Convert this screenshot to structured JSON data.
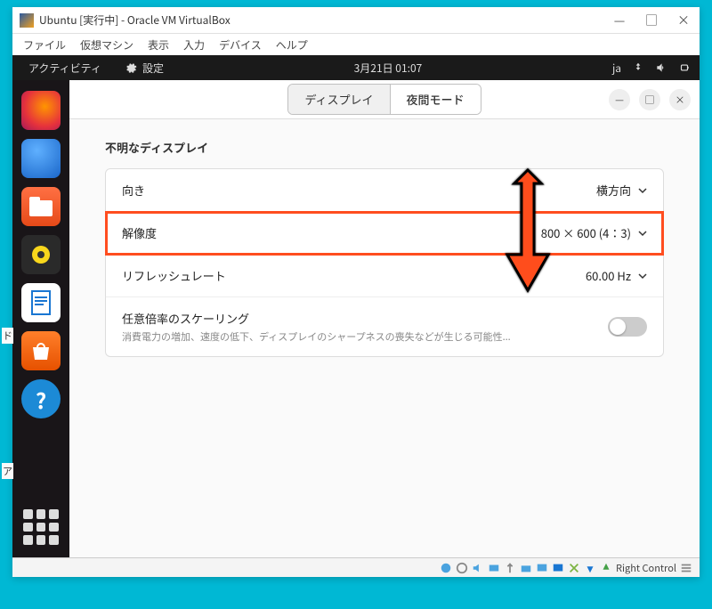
{
  "window": {
    "title": "Ubuntu [実行中] - Oracle VM VirtualBox",
    "minimize": "—",
    "maximize": "□",
    "close": "×"
  },
  "menubar": {
    "file": "ファイル",
    "machine": "仮想マシン",
    "view": "表示",
    "input": "入力",
    "device": "デバイス",
    "help": "ヘルプ"
  },
  "topbar": {
    "activities": "アクティビティ",
    "app": "設定",
    "date": "3月21日  01:07",
    "lang": "ja"
  },
  "header": {
    "tab_display": "ディスプレイ",
    "tab_night": "夜間モード",
    "minimize": "—",
    "maximize": "□",
    "close": "×"
  },
  "display": {
    "section_title": "不明なディスプレイ",
    "orientation": {
      "label": "向き",
      "value": "横方向"
    },
    "resolution": {
      "label": "解像度",
      "value": "800 × 600 (4：3)"
    },
    "refresh": {
      "label": "リフレッシュレート",
      "value": "60.00 Hz"
    },
    "scaling": {
      "label": "任意倍率のスケーリング",
      "sub": "消費電力の増加、速度の低下、ディスプレイのシャープネスの喪失などが生じる可能性...",
      "enabled": false
    }
  },
  "statusbar": {
    "host_key": "Right Control"
  },
  "edge_labels": {
    "left1": "ド",
    "left2": "ア"
  }
}
